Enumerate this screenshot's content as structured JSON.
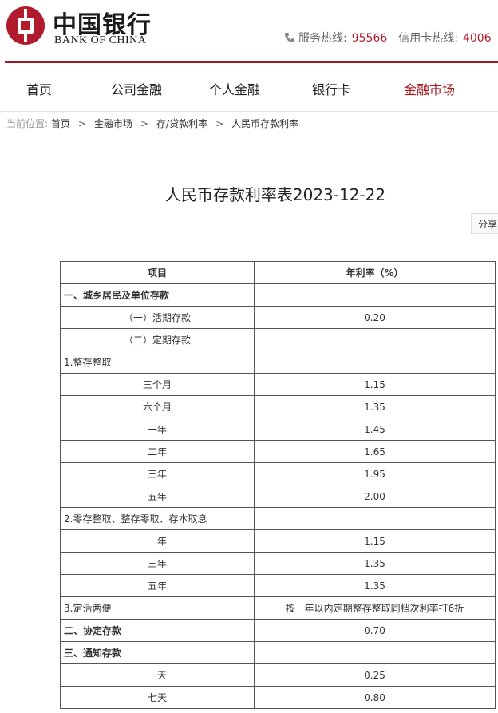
{
  "logo": {
    "cn": "中国银行",
    "en": "BANK OF CHINA"
  },
  "hotlines": {
    "service_label": "服务热线:",
    "service_num": "95566",
    "card_label": "信用卡热线:",
    "card_num": "4006"
  },
  "nav": [
    "首页",
    "公司金融",
    "个人金融",
    "银行卡",
    "金融市场"
  ],
  "breadcrumb": {
    "label": "当前位置:",
    "items": [
      "首页",
      "金融市场",
      "存/贷款利率",
      "人民币存款利率"
    ]
  },
  "title": "人民币存款利率表2023-12-22",
  "share_label": "分享",
  "table": {
    "headers": [
      "项目",
      "年利率（%）"
    ],
    "rows": [
      {
        "item": "一、城乡居民及单位存款",
        "rate": ""
      },
      {
        "item": "（一）活期存款",
        "rate": "0.20"
      },
      {
        "item": "（二）定期存款",
        "rate": ""
      },
      {
        "item": "1.整存整取",
        "rate": ""
      },
      {
        "item": "三个月",
        "rate": "1.15"
      },
      {
        "item": "六个月",
        "rate": "1.35"
      },
      {
        "item": "一年",
        "rate": "1.45"
      },
      {
        "item": "二年",
        "rate": "1.65"
      },
      {
        "item": "三年",
        "rate": "1.95"
      },
      {
        "item": "五年",
        "rate": "2.00"
      },
      {
        "item": "2.零存整取、整存零取、存本取息",
        "rate": ""
      },
      {
        "item": "一年",
        "rate": "1.15"
      },
      {
        "item": "三年",
        "rate": "1.35"
      },
      {
        "item": "五年",
        "rate": "1.35"
      },
      {
        "item": "3.定活两便",
        "rate": "按一年以内定期整存整取同档次利率打6折"
      },
      {
        "item": "二、协定存款",
        "rate": "0.70"
      },
      {
        "item": "三、通知存款",
        "rate": ""
      },
      {
        "item": "一天",
        "rate": "0.25"
      },
      {
        "item": "七天",
        "rate": "0.80"
      }
    ]
  }
}
